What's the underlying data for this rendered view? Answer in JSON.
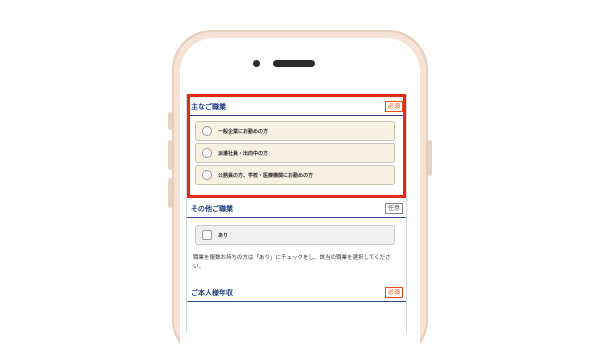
{
  "sections": {
    "main_job": {
      "title": "主なご職業",
      "badge": "必須",
      "options": [
        "一般企業にお勤めの方",
        "派遣社員・出向中の方",
        "公務員の方、学校・医療機関にお勤めの方"
      ]
    },
    "other_job": {
      "title": "その他ご職業",
      "badge": "任意",
      "checkbox_label": "あり",
      "note": "職業を複数お持ちの方は「あり」にチェックをし、該当の職業を選択してください。"
    },
    "income": {
      "title": "ご本人様年収",
      "badge": "必須"
    }
  },
  "colors": {
    "highlight": "#e8290f",
    "section_title": "#1f3e82",
    "required_badge": "#e8501b",
    "option_bg": "#f7f1e4",
    "phone_frame": "#f4e3d6"
  },
  "icons": [
    "camera-icon",
    "speaker-icon",
    "radio-icon",
    "checkbox-icon"
  ]
}
